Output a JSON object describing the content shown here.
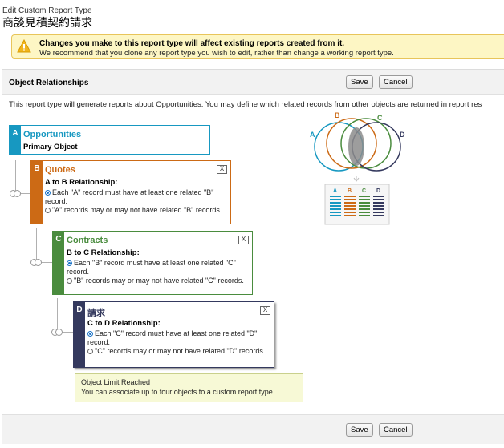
{
  "header": {
    "subtitle": "Edit Custom Report Type",
    "title": "商談見積契約請求"
  },
  "warning": {
    "line1": "Changes you make to this report type will affect existing reports created from it.",
    "line2": "We recommend that you clone any report type you wish to edit, rather than change a working report type."
  },
  "panel": {
    "title": "Object Relationships",
    "save_label": "Save",
    "cancel_label": "Cancel",
    "description": "This report type will generate reports about Opportunities. You may define which related records from other objects are returned in report res"
  },
  "objects": {
    "a": {
      "letter": "A",
      "name": "Opportunities",
      "subtitle": "Primary Object"
    },
    "b": {
      "letter": "B",
      "name": "Quotes",
      "close": "X",
      "relationship": "A to B Relationship:",
      "option1": "Each \"A\" record must have at least one related \"B\" record.",
      "option2": "\"A\" records may or may not have related \"B\" records."
    },
    "c": {
      "letter": "C",
      "name": "Contracts",
      "close": "X",
      "relationship": "B to C Relationship:",
      "option1": "Each \"B\" record must have at least one related \"C\" record.",
      "option2": "\"B\" records may or may not have related \"C\" records."
    },
    "d": {
      "letter": "D",
      "name": "請求",
      "close": "X",
      "relationship": "C to D Relationship:",
      "option1": "Each \"C\" record must have at least one related \"D\" record.",
      "option2": "\"C\" records may or may not have related \"D\" records."
    }
  },
  "venn": {
    "labels": [
      "A",
      "B",
      "C",
      "D"
    ],
    "columns": [
      "A",
      "B",
      "C",
      "D"
    ]
  },
  "limit": {
    "title": "Object Limit Reached",
    "detail": "You can associate up to four objects to a custom report type."
  },
  "colors": {
    "a": "#1798c1",
    "b": "#cc6a15",
    "c": "#4a8c3e",
    "d": "#34395e",
    "warning_bg": "#fdf6c4"
  }
}
